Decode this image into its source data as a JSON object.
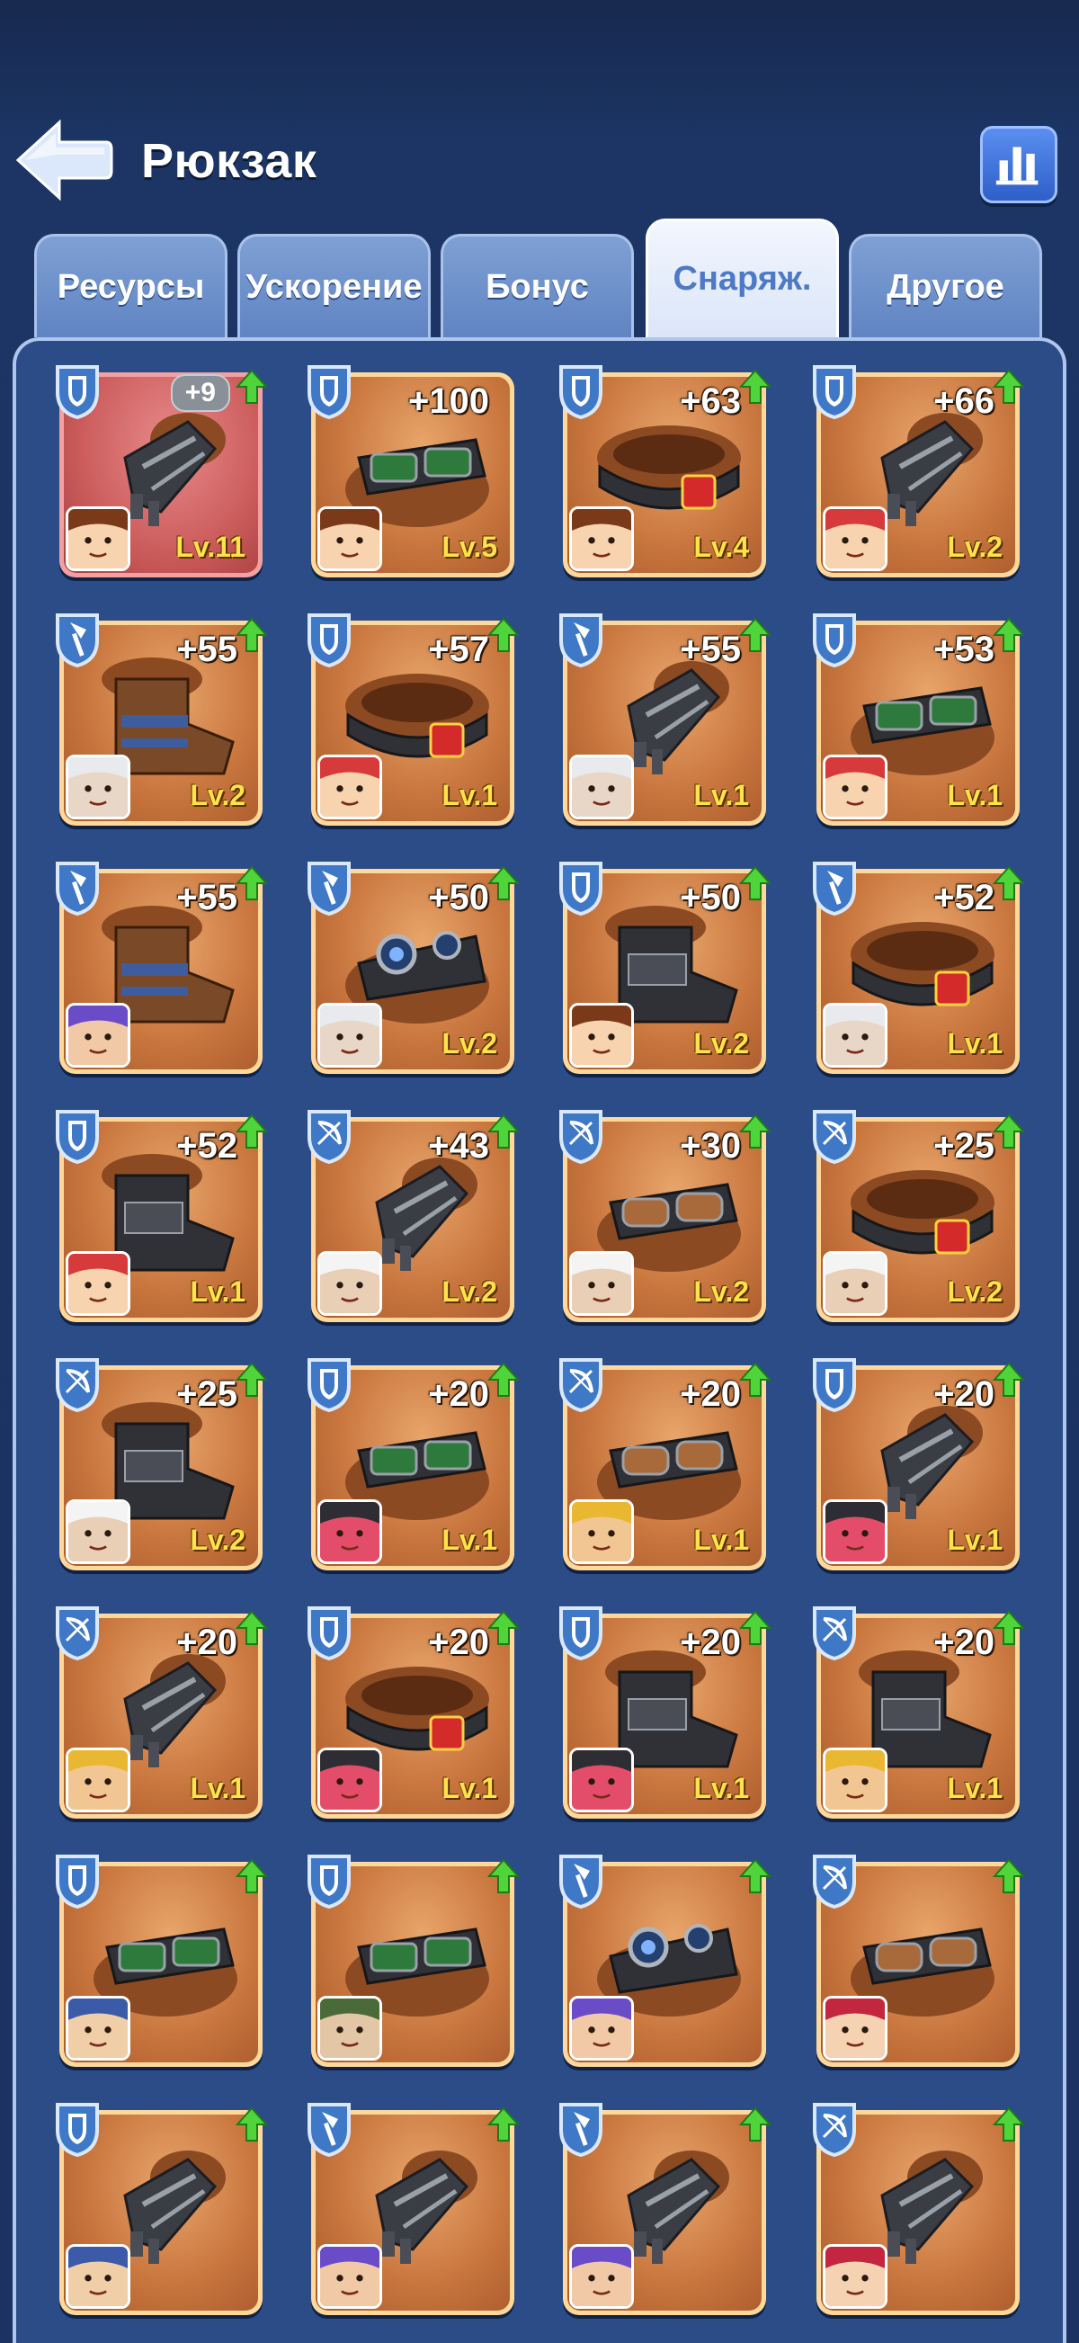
{
  "header": {
    "title": "Рюкзак"
  },
  "tabs": [
    {
      "label": "Ресурсы",
      "active": false
    },
    {
      "label": "Ускорение",
      "active": false
    },
    {
      "label": "Бонус",
      "active": false
    },
    {
      "label": "Снаряж.",
      "active": true
    },
    {
      "label": "Другое",
      "active": false
    }
  ],
  "items": [
    {
      "type": "shield",
      "item": "gauntlet",
      "bonus": "+9",
      "pill": true,
      "level": "Lv.11",
      "red": true,
      "avatar": "brown-hair",
      "arrow": true
    },
    {
      "type": "shield",
      "item": "goggles-green",
      "bonus": "+100",
      "level": "Lv.5",
      "avatar": "brown-hair",
      "arrow": false
    },
    {
      "type": "shield",
      "item": "belt-red",
      "bonus": "+63",
      "level": "Lv.4",
      "avatar": "brown-hair",
      "arrow": true
    },
    {
      "type": "shield",
      "item": "gauntlet",
      "bonus": "+66",
      "level": "Lv.2",
      "avatar": "red-cap",
      "arrow": true
    },
    {
      "type": "axe",
      "item": "boot-blue",
      "bonus": "+55",
      "level": "Lv.2",
      "avatar": "white-hair",
      "arrow": true
    },
    {
      "type": "shield",
      "item": "belt-red",
      "bonus": "+57",
      "level": "Lv.1",
      "avatar": "red-cap",
      "arrow": true
    },
    {
      "type": "axe",
      "item": "gauntlet",
      "bonus": "+55",
      "level": "Lv.1",
      "avatar": "white-hair",
      "arrow": true
    },
    {
      "type": "shield",
      "item": "goggles-green",
      "bonus": "+53",
      "level": "Lv.1",
      "avatar": "red-cap",
      "arrow": true
    },
    {
      "type": "axe",
      "item": "boot-blue",
      "bonus": "+55",
      "level": "",
      "avatar": "purple-viking",
      "arrow": true
    },
    {
      "type": "axe",
      "item": "goggles-blue",
      "bonus": "+50",
      "level": "Lv.2",
      "avatar": "white-hair",
      "arrow": true
    },
    {
      "type": "shield",
      "item": "boot-black",
      "bonus": "+50",
      "level": "Lv.2",
      "avatar": "brown-hair",
      "arrow": true
    },
    {
      "type": "axe",
      "item": "belt-red",
      "bonus": "+52",
      "level": "Lv.1",
      "avatar": "white-hair",
      "arrow": true
    },
    {
      "type": "shield",
      "item": "boot-black",
      "bonus": "+52",
      "level": "Lv.1",
      "avatar": "red-cap",
      "arrow": true
    },
    {
      "type": "bow",
      "item": "gauntlet",
      "bonus": "+43",
      "level": "Lv.2",
      "avatar": "old-man",
      "arrow": true
    },
    {
      "type": "bow",
      "item": "goggles-brown",
      "bonus": "+30",
      "level": "Lv.2",
      "avatar": "old-man",
      "arrow": true
    },
    {
      "type": "bow",
      "item": "belt-red",
      "bonus": "+25",
      "level": "Lv.2",
      "avatar": "old-man",
      "arrow": true
    },
    {
      "type": "bow",
      "item": "boot-black",
      "bonus": "+25",
      "level": "Lv.2",
      "avatar": "old-man",
      "arrow": true
    },
    {
      "type": "shield",
      "item": "goggles-green",
      "bonus": "+20",
      "level": "Lv.1",
      "avatar": "black-helm",
      "arrow": true
    },
    {
      "type": "bow",
      "item": "goggles-brown",
      "bonus": "+20",
      "level": "Lv.1",
      "avatar": "yellow-helm",
      "arrow": true
    },
    {
      "type": "shield",
      "item": "gauntlet",
      "bonus": "+20",
      "level": "Lv.1",
      "avatar": "black-helm",
      "arrow": true
    },
    {
      "type": "bow",
      "item": "gauntlet",
      "bonus": "+20",
      "level": "Lv.1",
      "avatar": "yellow-helm",
      "arrow": true
    },
    {
      "type": "shield",
      "item": "belt-red",
      "bonus": "+20",
      "level": "Lv.1",
      "avatar": "black-helm",
      "arrow": true
    },
    {
      "type": "shield",
      "item": "boot-black",
      "bonus": "+20",
      "level": "Lv.1",
      "avatar": "black-helm",
      "arrow": true
    },
    {
      "type": "bow",
      "item": "boot-black",
      "bonus": "+20",
      "level": "Lv.1",
      "avatar": "yellow-helm",
      "arrow": true
    },
    {
      "type": "shield",
      "item": "goggles-green",
      "bonus": "",
      "level": "",
      "avatar": "blue-beard",
      "arrow": true
    },
    {
      "type": "shield",
      "item": "goggles-green",
      "bonus": "",
      "level": "",
      "avatar": "green-helm",
      "arrow": true
    },
    {
      "type": "axe",
      "item": "goggles-blue",
      "bonus": "",
      "level": "",
      "avatar": "purple-viking",
      "arrow": true
    },
    {
      "type": "bow",
      "item": "goggles-brown",
      "bonus": "",
      "level": "",
      "avatar": "red-girl",
      "arrow": true
    },
    {
      "type": "shield",
      "item": "gauntlet",
      "bonus": "",
      "level": "",
      "avatar": "blue-beard",
      "arrow": true
    },
    {
      "type": "axe",
      "item": "gauntlet",
      "bonus": "",
      "level": "",
      "avatar": "purple-viking",
      "arrow": true
    },
    {
      "type": "axe",
      "item": "gauntlet",
      "bonus": "",
      "level": "",
      "avatar": "purple-viking",
      "arrow": true
    },
    {
      "type": "bow",
      "item": "gauntlet",
      "bonus": "",
      "level": "",
      "avatar": "red-girl",
      "arrow": true
    }
  ]
}
